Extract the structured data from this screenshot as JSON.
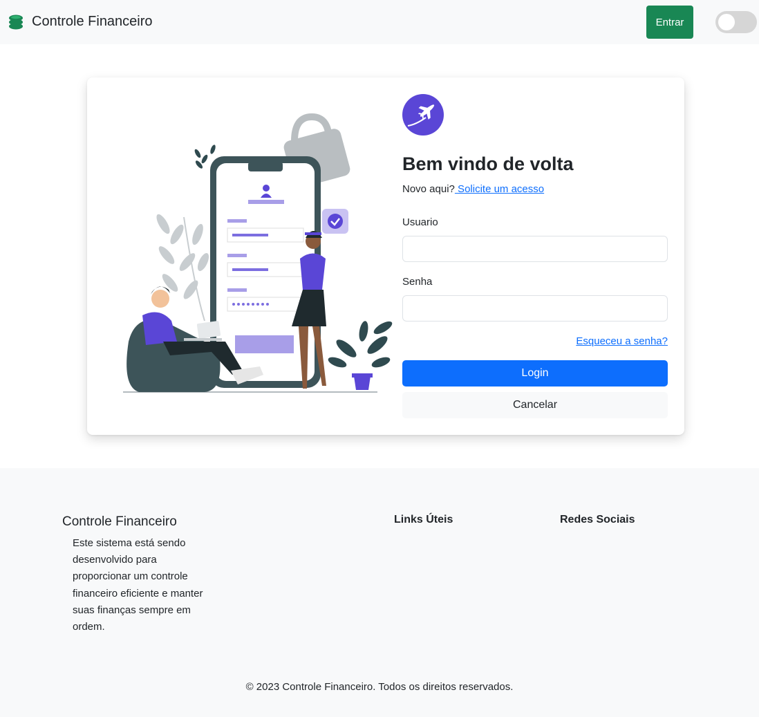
{
  "navbar": {
    "brand_text": "Controle Financeiro",
    "brand_icon": "coins-stack-icon",
    "login_button": "Entrar",
    "theme_toggle_on": false
  },
  "login": {
    "logo_icon": "airplane-icon",
    "title": "Bem vindo de volta",
    "signup_prompt": "Novo aqui?",
    "signup_link": " Solicite um acesso",
    "username_label": "Usuario",
    "username_value": "",
    "password_label": "Senha",
    "password_value": "",
    "forgot_link": "Esqueceu a senha?",
    "login_button": "Login",
    "cancel_button": "Cancelar"
  },
  "footer": {
    "title": "Controle Financeiro",
    "description": "Este sistema está sendo desenvolvido para proporcionar um controle financeiro eficiente e manter suas finanças sempre em ordem.",
    "links_heading": "Links Úteis",
    "social_heading": "Redes Sociais",
    "copyright": "© 2023 Controle Financeiro. Todos os direitos reservados."
  },
  "colors": {
    "success": "#198754",
    "primary": "#0d6efd",
    "accent_purple": "#5a46d6",
    "light_bg": "#f8f9fa"
  }
}
